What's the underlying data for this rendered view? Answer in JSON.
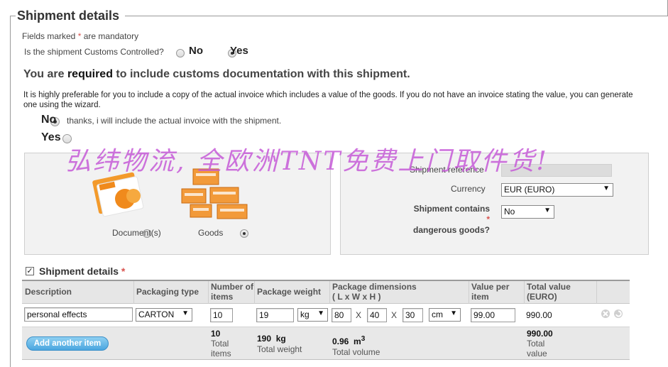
{
  "section_title": "Shipment details",
  "mandatory_note_prefix": "Fields marked",
  "mandatory_star": "*",
  "mandatory_note_suffix": "are mandatory",
  "customs_question": "Is the shipment Customs Controlled?",
  "customs_options": {
    "no": "No",
    "yes": "Yes",
    "selected": "yes"
  },
  "customs_heading": {
    "prefix": "You are",
    "emphasis": "required",
    "suffix": "to include customs documentation with this shipment."
  },
  "invoice_paragraph": "It is highly preferable for you to include a copy of the actual invoice which includes a value of the goods. If you do not have an invoice stating the value, you can generate one using the wizard.",
  "invoice_options": {
    "no": "No",
    "no_note": "thanks, i will include the actual invoice with the shipment.",
    "yes": "Yes",
    "selected": "no"
  },
  "watermark": "弘纬物流, 全欧洲TNT免费上门取件货!",
  "content_type": {
    "document": "Document(s)",
    "goods": "Goods",
    "selected": "goods"
  },
  "right_panel": {
    "shipment_reference_label": "Shipment reference",
    "currency_label": "Currency",
    "currency_value": "EUR (EURO)",
    "dangerous_label_1": "Shipment contains",
    "dangerous_label_2": "dangerous goods?",
    "dangerous_value": "No"
  },
  "details_checkbox_label": "Shipment details",
  "table": {
    "headers": {
      "description": "Description",
      "packaging": "Packaging type",
      "number_1": "Number of",
      "number_2": "items",
      "weight": "Package weight",
      "dims_1": "Package dimensions",
      "dims_2": "( L x W x H )",
      "value_1": "Value per",
      "value_2": "item",
      "total_1": "Total value",
      "total_2": "(EURO)"
    },
    "row": {
      "description": "personal effects",
      "packaging": "CARTON",
      "number": "10",
      "weight": "19",
      "weight_unit": "kg",
      "length": "80",
      "width": "40",
      "height": "30",
      "x_sep": "X",
      "dim_unit": "cm",
      "value": "99.00",
      "total": "990.00"
    },
    "footer": {
      "add_button": "Add another item",
      "total_items_value": "10",
      "total_items_label_1": "Total",
      "total_items_label_2": "items",
      "total_weight_value": "190",
      "total_weight_unit": "kg",
      "total_weight_label": "Total weight",
      "total_volume_value": "0.96",
      "total_volume_unit": "m",
      "total_volume_exp": "3",
      "total_volume_label": "Total volume",
      "total_value_value": "990.00",
      "total_value_label_1": "Total",
      "total_value_label_2": "value"
    }
  }
}
